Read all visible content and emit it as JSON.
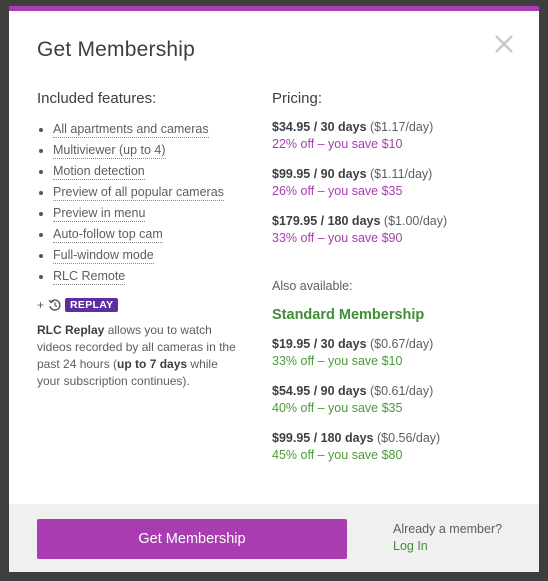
{
  "title": "Get Membership",
  "features": {
    "heading": "Included features:",
    "items": [
      "All apartments and cameras",
      "Multiviewer (up to 4)",
      "Motion detection",
      "Preview of all popular cameras",
      "Preview in menu",
      "Auto-follow top cam",
      "Full-window mode",
      "RLC Remote"
    ],
    "plus": "+",
    "replay_badge": "REPLAY",
    "replay_desc": {
      "lead": "RLC Replay",
      "text1": " allows you to watch videos recorded by all cameras in the past 24 hours (",
      "bold2": "up to 7 days",
      "text2": " while your subscription continues)."
    }
  },
  "pricing": {
    "heading": "Pricing:",
    "plans": [
      {
        "price": "$34.95 / 30 days",
        "perday": " ($1.17/day)",
        "save": "22% off – you save $10"
      },
      {
        "price": "$99.95 / 90 days",
        "perday": " ($1.11/day)",
        "save": "26% off – you save $35"
      },
      {
        "price": "$179.95 / 180 days",
        "perday": " ($1.00/day)",
        "save": "33% off – you save $90"
      }
    ],
    "also_available": "Also available:",
    "standard_title": "Standard Membership",
    "standard_plans": [
      {
        "price": "$19.95 / 30 days",
        "perday": " ($0.67/day)",
        "save": "33% off – you save $10"
      },
      {
        "price": "$54.95 / 90 days",
        "perday": " ($0.61/day)",
        "save": "40% off – you save $35"
      },
      {
        "price": "$99.95 / 180 days",
        "perday": " ($0.56/day)",
        "save": "45% off – you save $80"
      }
    ]
  },
  "footer": {
    "button_label": "Get Membership",
    "already_member": "Already a member?",
    "login": "Log In"
  },
  "colors": {
    "accent_purple": "#a83cb0",
    "accent_green": "#3f8e34",
    "replay_badge": "#5b2fa0"
  },
  "icons": {
    "close": "close-icon",
    "replay": "replay-icon"
  }
}
